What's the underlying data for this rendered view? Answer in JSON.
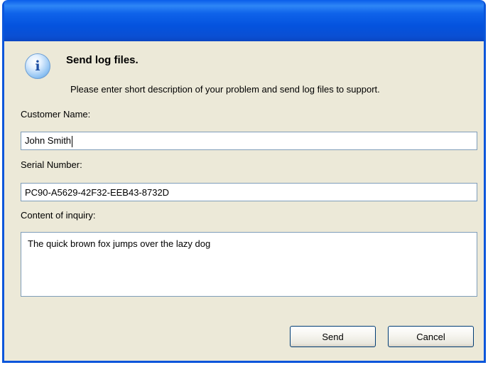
{
  "dialog": {
    "heading": "Send log files.",
    "description": "Please enter short description of your problem and send log files to support."
  },
  "icon": "info-icon",
  "form": {
    "customer_name_label": "Customer Name:",
    "customer_name_value": "John Smith",
    "serial_number_label": "Serial Number:",
    "serial_number_value": "PC90-A5629-42F32-EEB43-8732D",
    "inquiry_label": "Content of inquiry:",
    "inquiry_value": "The quick brown fox jumps over the lazy dog"
  },
  "buttons": {
    "send_label": "Send",
    "cancel_label": "Cancel"
  },
  "colors": {
    "titlebar": "#0453DE",
    "window_face": "#ECE9D8",
    "field_border": "#7F9DB9",
    "button_border": "#003C74"
  }
}
